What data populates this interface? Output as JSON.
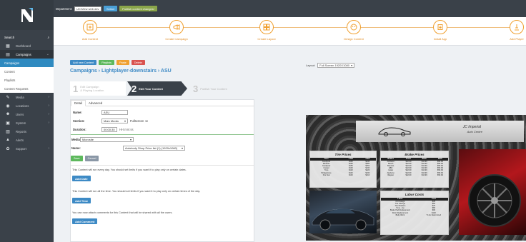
{
  "sidebar": {
    "search_label": "Search",
    "items": [
      {
        "label": "Dashboard",
        "icon": "dashboard-icon"
      },
      {
        "label": "Campaigns",
        "icon": "campaigns-icon"
      },
      {
        "label": "Media",
        "icon": "media-icon"
      },
      {
        "label": "Locations",
        "icon": "locations-icon"
      },
      {
        "label": "Users",
        "icon": "users-icon"
      },
      {
        "label": "System",
        "icon": "system-icon"
      },
      {
        "label": "Reports",
        "icon": "reports-icon"
      },
      {
        "label": "Alerts",
        "icon": "alerts-icon"
      },
      {
        "label": "Support",
        "icon": "support-icon"
      }
    ],
    "sub_items": [
      "Campaigns",
      "Content",
      "Playlists",
      "Content Requests"
    ]
  },
  "topbar": {
    "department_label": "Department:",
    "department_value": "UC/View web dev",
    "select_label": "Select",
    "publish_label": "Publish content changes!"
  },
  "steps": {
    "items": [
      "Add Content",
      "Create Campaign",
      "Create Layout",
      "Design Content",
      "Install App",
      "Add Player"
    ]
  },
  "actions": {
    "add_new_content": "Add new Content",
    "playlists": "Playlists",
    "paste": "Paste",
    "delete": "Delete"
  },
  "breadcrumb": "Campaigns › Lightplayer-downstairs › ASU",
  "wizard": {
    "s1_num": "1",
    "s1_text_a": "Edit Campaign",
    "s1_text_b": "& Playing Location",
    "s2_num": "2",
    "s2_text": "Edit Your Content",
    "s3_num": "3",
    "s3_text": "Publish Your Content"
  },
  "form": {
    "tab_detail": "Detail",
    "tab_advanced": "Advanced",
    "name_label": "Name:",
    "name_value": "ASU",
    "section_label": "Section:",
    "section_value": "Main Media",
    "fullscreen_label": "Fullscreen",
    "duration_label": "Duration:",
    "duration_value": "00:00:30",
    "duration_hint": "HH:mm:ss",
    "media_label": "Media:",
    "media_value": "Microsite",
    "media_name_label": "Name:",
    "media_name_value": "Autobody Shop Price list (1) (1920x1080)",
    "save": "Save",
    "cancel": "Cancel",
    "note_date": "This Content will run every day. You should set limits if you want it to play only on certain dates.",
    "add_date": "Add Date",
    "note_time": "This Content will run all the time. You should set limits if you want it to play only on certain times of the day.",
    "add_time": "Add Time",
    "note_comment": "You can now attach comments for this Content that will be shared with all the users.",
    "add_comment": "Add Comment"
  },
  "preview": {
    "layout_label": "Layout:",
    "layout_value": "Full Screen 1920X1080",
    "tire_title": "Tire Prices",
    "brake_title": "Brake Prices",
    "labor_title": "Labor Costs",
    "tire_headers": [
      "Tires",
      "2 Set",
      "4 Set"
    ],
    "tire_rows": [
      [
        "Goodyear",
        "$140",
        "$240"
      ],
      [
        "Michelin",
        "$160",
        "$280"
      ],
      [
        "Goodyear",
        "$150",
        "$250"
      ],
      [
        "Cooper",
        "$130",
        "$230"
      ],
      [
        "Toyo",
        "$120",
        "$220"
      ],
      [
        "Bridgestone",
        "$140",
        "$230"
      ],
      [
        "Fire Stat",
        "$130",
        "$210"
      ]
    ],
    "brake_headers": [
      "Brakes",
      "Front",
      "Back",
      "Both"
    ],
    "brake_rows": [
      [
        "ACDelco",
        "$42.99",
        "$44.99",
        "$59.99"
      ],
      [
        "Bosch",
        "$42.99",
        "$44.99",
        "$59.99"
      ],
      [
        "Brembo",
        "$42.99",
        "$44.99",
        "$59.99"
      ],
      [
        "EBC",
        "$42.99",
        "$44.99",
        "$59.99"
      ],
      [
        "Hawk",
        "$42.99",
        "$44.99",
        "$59.99"
      ],
      [
        "Akebono",
        "$42.99",
        "$44.99",
        "$59.99"
      ],
      [
        "Wagner",
        "$42.99",
        "$44.99",
        "$59.99"
      ]
    ],
    "labor_headers": [
      "Labor",
      "Cost"
    ],
    "labor_rows": [
      [
        "Oil Change",
        "$35"
      ],
      [
        "Tire Change",
        "$50"
      ],
      [
        "Tire Rotation",
        "$25"
      ],
      [
        "Tune - Up",
        "$80"
      ],
      [
        "Brake Pad Replacement",
        "$90"
      ],
      [
        "Rotor Replacement",
        "$120"
      ],
      [
        "Body Work",
        "To be Determined"
      ]
    ],
    "brand_script": "JC Imperial",
    "brand_sub": "Auto Centre"
  },
  "colors": {
    "sidebar_bg": "#3a4149",
    "accent_blue": "#3d8ac5",
    "accent_green": "#5cb85c",
    "accent_orange": "#f0a030"
  }
}
